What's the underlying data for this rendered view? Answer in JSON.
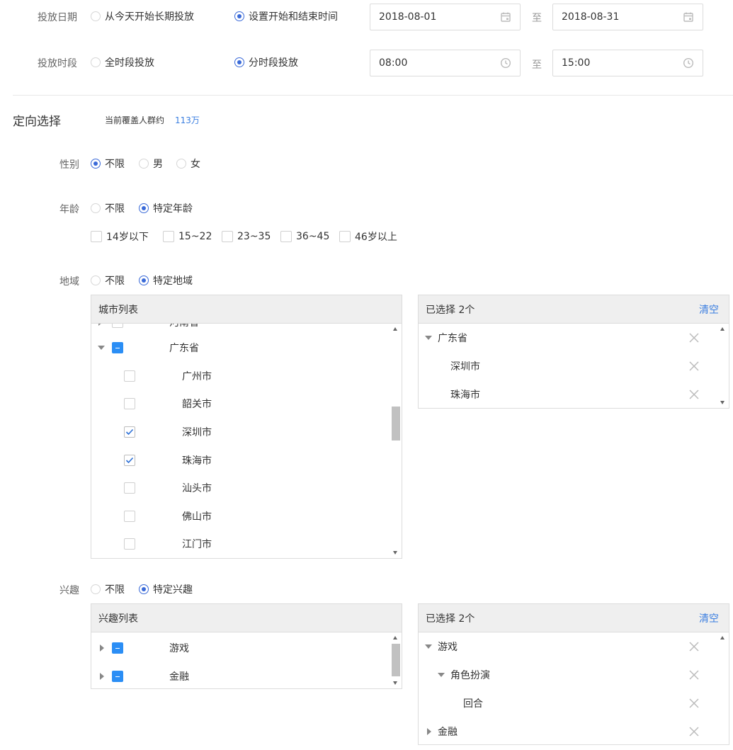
{
  "schedule": {
    "date_label": "投放日期",
    "date_options": [
      "从今天开始长期投放",
      "设置开始和结束时间"
    ],
    "date_selected": 1,
    "start_date": "2018-08-01",
    "end_date": "2018-08-31",
    "to_label": "至",
    "time_label": "投放时段",
    "time_options": [
      "全时段投放",
      "分时段投放"
    ],
    "time_selected": 1,
    "start_time": "08:00",
    "end_time": "15:00"
  },
  "targeting": {
    "title": "定向选择",
    "coverage_label": "当前覆盖人群约",
    "coverage_value": "113万",
    "gender": {
      "label": "性别",
      "options": [
        "不限",
        "男",
        "女"
      ],
      "selected": 0
    },
    "age": {
      "label": "年龄",
      "options": [
        "不限",
        "特定年龄"
      ],
      "selected": 1,
      "ranges": [
        "14岁以下",
        "15~22",
        "23~35",
        "36~45",
        "46岁以上"
      ]
    },
    "region": {
      "label": "地域",
      "options": [
        "不限",
        "特定地域"
      ],
      "selected": 1,
      "list_header": "城市列表",
      "partial_label": "河南省",
      "province": "广东省",
      "cities": [
        {
          "name": "广州市",
          "checked": false
        },
        {
          "name": "韶关市",
          "checked": false
        },
        {
          "name": "深圳市",
          "checked": true
        },
        {
          "name": "珠海市",
          "checked": true
        },
        {
          "name": "汕头市",
          "checked": false
        },
        {
          "name": "佛山市",
          "checked": false
        },
        {
          "name": "江门市",
          "checked": false
        }
      ],
      "selected_header": "已选择 2个",
      "clear_label": "清空",
      "selected_items": [
        "广东省",
        "深圳市",
        "珠海市"
      ]
    },
    "interest": {
      "label": "兴趣",
      "options": [
        "不限",
        "特定兴趣"
      ],
      "selected": 1,
      "list_header": "兴趣列表",
      "categories": [
        "游戏",
        "金融"
      ],
      "selected_header": "已选择 2个",
      "clear_label": "清空",
      "selected_items": [
        "游戏",
        "角色扮演",
        "回合",
        "金融"
      ]
    }
  },
  "colors": {
    "accent": "#3a6ad8",
    "link": "#3a7ee0",
    "checkbox_blue": "#2b8ef5"
  }
}
